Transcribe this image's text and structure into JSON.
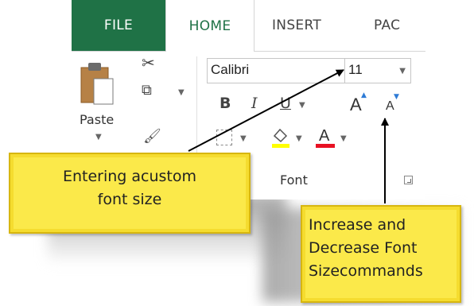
{
  "tabs": {
    "file": "FILE",
    "home": "HOME",
    "insert": "INSERT",
    "page": "PAC"
  },
  "clipboard": {
    "paste_label": "Paste"
  },
  "font": {
    "name_value": "Calibri",
    "size_value": "11",
    "bold": "B",
    "italic": "I",
    "underline": "U",
    "grow": "A",
    "shrink": "A",
    "group_label": "Font"
  },
  "callouts": {
    "custom_size": {
      "line1": "Entering acustom",
      "line2": "font size"
    },
    "increase_decrease": {
      "line1": "Increase and",
      "line2": "Decrease Font",
      "line3": "Sizecommands"
    }
  },
  "colors": {
    "file_tab": "#1f7246",
    "callout_fill": "#fbe94a",
    "font_color_bar": "#e81123",
    "highlight_bar": "#ffff00"
  }
}
